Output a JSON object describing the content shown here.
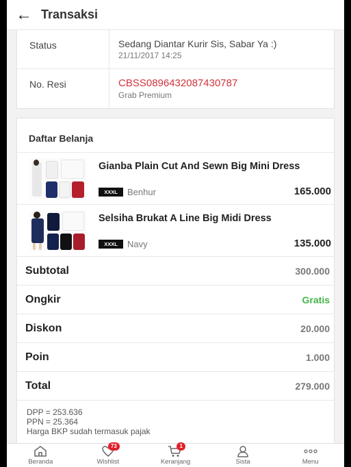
{
  "header": {
    "title": "Transaksi"
  },
  "info": {
    "status_label": "Status",
    "status_value": "Sedang Diantar Kurir Sis, Sabar Ya :)",
    "status_time": "21/11/2017 14:25",
    "resi_label": "No. Resi",
    "resi_value": "CBSS0896432087430787",
    "resi_courier": "Grab Premium"
  },
  "cart": {
    "title": "Daftar Belanja",
    "items": [
      {
        "name": "Gianba Plain Cut And Sewn Big Mini Dress",
        "size": "XXXL",
        "variant": "Benhur",
        "price": "165.000"
      },
      {
        "name": "Selsiha Brukat A Line Big Midi Dress",
        "size": "XXXL",
        "variant": "Navy",
        "price": "135.000"
      }
    ]
  },
  "summary": {
    "subtotal_label": "Subtotal",
    "subtotal": "300.000",
    "ongkir_label": "Ongkir",
    "ongkir": "Gratis",
    "diskon_label": "Diskon",
    "diskon": "20.000",
    "poin_label": "Poin",
    "poin": "1.000",
    "total_label": "Total",
    "total": "279.000"
  },
  "notes": {
    "dpp": "DPP = 253.636",
    "ppn": "PPN = 25.364",
    "tax": "Harga BKP sudah termasuk pajak"
  },
  "nav": {
    "beranda": "Beranda",
    "wishlist": "Wishlist",
    "wishlist_badge": "73",
    "keranjang": "Keranjang",
    "keranjang_badge": "1",
    "sista": "Sista",
    "menu": "Menu"
  },
  "colors": {
    "accent_red": "#d0343c",
    "green": "#42b549",
    "badge": "#e1212a"
  }
}
